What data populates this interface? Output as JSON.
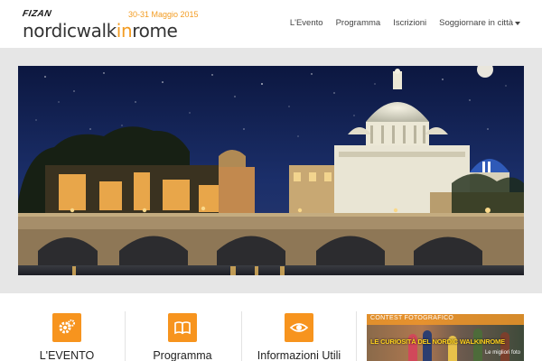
{
  "header": {
    "sponsor": "FIZAN",
    "dates": "30-31 Maggio 2015",
    "wordmark_pre": "nordicwalk",
    "wordmark_accent": "in",
    "wordmark_post": "rome"
  },
  "nav": {
    "items": [
      {
        "label": "L'Evento"
      },
      {
        "label": "Programma"
      },
      {
        "label": "Iscrizioni"
      },
      {
        "label": "Soggiornare in città"
      }
    ]
  },
  "hero": {
    "image": "night-view-rome-st-peters-basilica-ponte-sant-angelo",
    "paused": true
  },
  "features": [
    {
      "icon": "gears-icon",
      "label": "L'EVENTO"
    },
    {
      "icon": "book-icon",
      "label": "Programma"
    },
    {
      "icon": "eye-icon",
      "label": "Informazioni Utili"
    }
  ],
  "contest": {
    "title": "CONTEST FOTOGRAFICO",
    "headline": "LE CURIOSITÀ DEL NORDIC WALKINROME",
    "subtitle": "Le migliori foto"
  },
  "colors": {
    "accent": "#f39c22",
    "icon_bg": "#f7941e",
    "band_bg": "#e6e6e6",
    "night_sky": "#101e44"
  }
}
